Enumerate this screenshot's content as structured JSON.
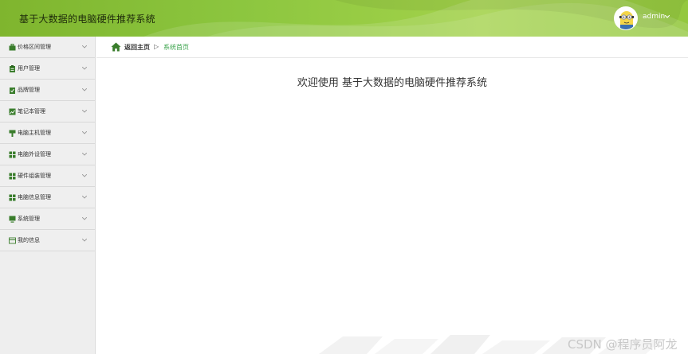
{
  "header": {
    "title": "基于大数据的电脑硬件推荐系统",
    "user_name": "admin",
    "colors": {
      "primary": "#8cc63f",
      "dark": "#7fb52e"
    }
  },
  "sidebar": {
    "items": [
      {
        "label": "价格区间管理",
        "icon": "briefcase-icon"
      },
      {
        "label": "用户管理",
        "icon": "clipboard-icon"
      },
      {
        "label": "品牌管理",
        "icon": "checklist-icon"
      },
      {
        "label": "笔记本管理",
        "icon": "chart-icon"
      },
      {
        "label": "电脑主机管理",
        "icon": "pin-icon"
      },
      {
        "label": "电脑外设管理",
        "icon": "grid-icon"
      },
      {
        "label": "硬件组装管理",
        "icon": "grid-icon"
      },
      {
        "label": "电脑信息管理",
        "icon": "grid-icon"
      },
      {
        "label": "系统管理",
        "icon": "monitor-icon"
      },
      {
        "label": "我的信息",
        "icon": "card-icon"
      }
    ]
  },
  "breadcrumb": {
    "home": "返回主页",
    "separator": "▷",
    "current": "系统首页"
  },
  "main": {
    "welcome": "欢迎使用 基于大数据的电脑硬件推荐系统"
  },
  "watermark": "CSDN @程序员阿龙"
}
